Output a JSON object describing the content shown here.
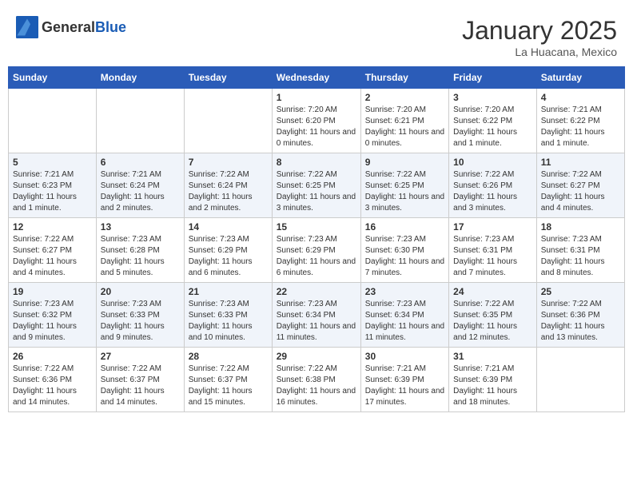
{
  "header": {
    "logo_general": "General",
    "logo_blue": "Blue",
    "month_title": "January 2025",
    "location": "La Huacana, Mexico"
  },
  "weekdays": [
    "Sunday",
    "Monday",
    "Tuesday",
    "Wednesday",
    "Thursday",
    "Friday",
    "Saturday"
  ],
  "weeks": [
    [
      {
        "day": "",
        "sunrise": "",
        "sunset": "",
        "daylight": ""
      },
      {
        "day": "",
        "sunrise": "",
        "sunset": "",
        "daylight": ""
      },
      {
        "day": "",
        "sunrise": "",
        "sunset": "",
        "daylight": ""
      },
      {
        "day": "1",
        "sunrise": "Sunrise: 7:20 AM",
        "sunset": "Sunset: 6:20 PM",
        "daylight": "Daylight: 11 hours and 0 minutes."
      },
      {
        "day": "2",
        "sunrise": "Sunrise: 7:20 AM",
        "sunset": "Sunset: 6:21 PM",
        "daylight": "Daylight: 11 hours and 0 minutes."
      },
      {
        "day": "3",
        "sunrise": "Sunrise: 7:20 AM",
        "sunset": "Sunset: 6:22 PM",
        "daylight": "Daylight: 11 hours and 1 minute."
      },
      {
        "day": "4",
        "sunrise": "Sunrise: 7:21 AM",
        "sunset": "Sunset: 6:22 PM",
        "daylight": "Daylight: 11 hours and 1 minute."
      }
    ],
    [
      {
        "day": "5",
        "sunrise": "Sunrise: 7:21 AM",
        "sunset": "Sunset: 6:23 PM",
        "daylight": "Daylight: 11 hours and 1 minute."
      },
      {
        "day": "6",
        "sunrise": "Sunrise: 7:21 AM",
        "sunset": "Sunset: 6:24 PM",
        "daylight": "Daylight: 11 hours and 2 minutes."
      },
      {
        "day": "7",
        "sunrise": "Sunrise: 7:22 AM",
        "sunset": "Sunset: 6:24 PM",
        "daylight": "Daylight: 11 hours and 2 minutes."
      },
      {
        "day": "8",
        "sunrise": "Sunrise: 7:22 AM",
        "sunset": "Sunset: 6:25 PM",
        "daylight": "Daylight: 11 hours and 3 minutes."
      },
      {
        "day": "9",
        "sunrise": "Sunrise: 7:22 AM",
        "sunset": "Sunset: 6:25 PM",
        "daylight": "Daylight: 11 hours and 3 minutes."
      },
      {
        "day": "10",
        "sunrise": "Sunrise: 7:22 AM",
        "sunset": "Sunset: 6:26 PM",
        "daylight": "Daylight: 11 hours and 3 minutes."
      },
      {
        "day": "11",
        "sunrise": "Sunrise: 7:22 AM",
        "sunset": "Sunset: 6:27 PM",
        "daylight": "Daylight: 11 hours and 4 minutes."
      }
    ],
    [
      {
        "day": "12",
        "sunrise": "Sunrise: 7:22 AM",
        "sunset": "Sunset: 6:27 PM",
        "daylight": "Daylight: 11 hours and 4 minutes."
      },
      {
        "day": "13",
        "sunrise": "Sunrise: 7:23 AM",
        "sunset": "Sunset: 6:28 PM",
        "daylight": "Daylight: 11 hours and 5 minutes."
      },
      {
        "day": "14",
        "sunrise": "Sunrise: 7:23 AM",
        "sunset": "Sunset: 6:29 PM",
        "daylight": "Daylight: 11 hours and 6 minutes."
      },
      {
        "day": "15",
        "sunrise": "Sunrise: 7:23 AM",
        "sunset": "Sunset: 6:29 PM",
        "daylight": "Daylight: 11 hours and 6 minutes."
      },
      {
        "day": "16",
        "sunrise": "Sunrise: 7:23 AM",
        "sunset": "Sunset: 6:30 PM",
        "daylight": "Daylight: 11 hours and 7 minutes."
      },
      {
        "day": "17",
        "sunrise": "Sunrise: 7:23 AM",
        "sunset": "Sunset: 6:31 PM",
        "daylight": "Daylight: 11 hours and 7 minutes."
      },
      {
        "day": "18",
        "sunrise": "Sunrise: 7:23 AM",
        "sunset": "Sunset: 6:31 PM",
        "daylight": "Daylight: 11 hours and 8 minutes."
      }
    ],
    [
      {
        "day": "19",
        "sunrise": "Sunrise: 7:23 AM",
        "sunset": "Sunset: 6:32 PM",
        "daylight": "Daylight: 11 hours and 9 minutes."
      },
      {
        "day": "20",
        "sunrise": "Sunrise: 7:23 AM",
        "sunset": "Sunset: 6:33 PM",
        "daylight": "Daylight: 11 hours and 9 minutes."
      },
      {
        "day": "21",
        "sunrise": "Sunrise: 7:23 AM",
        "sunset": "Sunset: 6:33 PM",
        "daylight": "Daylight: 11 hours and 10 minutes."
      },
      {
        "day": "22",
        "sunrise": "Sunrise: 7:23 AM",
        "sunset": "Sunset: 6:34 PM",
        "daylight": "Daylight: 11 hours and 11 minutes."
      },
      {
        "day": "23",
        "sunrise": "Sunrise: 7:23 AM",
        "sunset": "Sunset: 6:34 PM",
        "daylight": "Daylight: 11 hours and 11 minutes."
      },
      {
        "day": "24",
        "sunrise": "Sunrise: 7:22 AM",
        "sunset": "Sunset: 6:35 PM",
        "daylight": "Daylight: 11 hours and 12 minutes."
      },
      {
        "day": "25",
        "sunrise": "Sunrise: 7:22 AM",
        "sunset": "Sunset: 6:36 PM",
        "daylight": "Daylight: 11 hours and 13 minutes."
      }
    ],
    [
      {
        "day": "26",
        "sunrise": "Sunrise: 7:22 AM",
        "sunset": "Sunset: 6:36 PM",
        "daylight": "Daylight: 11 hours and 14 minutes."
      },
      {
        "day": "27",
        "sunrise": "Sunrise: 7:22 AM",
        "sunset": "Sunset: 6:37 PM",
        "daylight": "Daylight: 11 hours and 14 minutes."
      },
      {
        "day": "28",
        "sunrise": "Sunrise: 7:22 AM",
        "sunset": "Sunset: 6:37 PM",
        "daylight": "Daylight: 11 hours and 15 minutes."
      },
      {
        "day": "29",
        "sunrise": "Sunrise: 7:22 AM",
        "sunset": "Sunset: 6:38 PM",
        "daylight": "Daylight: 11 hours and 16 minutes."
      },
      {
        "day": "30",
        "sunrise": "Sunrise: 7:21 AM",
        "sunset": "Sunset: 6:39 PM",
        "daylight": "Daylight: 11 hours and 17 minutes."
      },
      {
        "day": "31",
        "sunrise": "Sunrise: 7:21 AM",
        "sunset": "Sunset: 6:39 PM",
        "daylight": "Daylight: 11 hours and 18 minutes."
      },
      {
        "day": "",
        "sunrise": "",
        "sunset": "",
        "daylight": ""
      }
    ]
  ]
}
